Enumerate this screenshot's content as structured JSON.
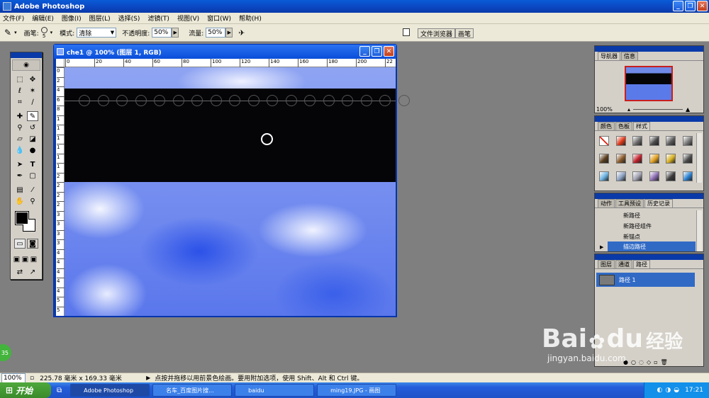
{
  "window": {
    "title": "Adobe Photoshop",
    "minimize": "_",
    "restore": "❐",
    "close": "✕"
  },
  "menu": [
    "文件(F)",
    "编辑(E)",
    "图像(I)",
    "图层(L)",
    "选择(S)",
    "滤镜(T)",
    "视图(V)",
    "窗口(W)",
    "帮助(H)"
  ],
  "options": {
    "brush_label": "画笔:",
    "brush_size": "5",
    "mode_label": "模式:",
    "mode_value": "清除",
    "opacity_label": "不透明度:",
    "opacity_value": "50%",
    "flow_label": "流量:",
    "flow_value": "50%",
    "tab_file_browser": "文件浏览器",
    "tab_brushes": "画笔"
  },
  "document": {
    "title": "che1 @ 100% (图层 1, RGB)",
    "ruler_top": [
      "0",
      "20",
      "40",
      "60",
      "80",
      "100",
      "120",
      "140",
      "160",
      "180",
      "200",
      "22"
    ],
    "ruler_left": [
      "0",
      "2",
      "4",
      "6",
      "8",
      "1",
      "1",
      "1",
      "1",
      "1",
      "1",
      "2",
      "2",
      "2",
      "2",
      "3",
      "3",
      "3",
      "3",
      "4",
      "4",
      "4",
      "4",
      "4",
      "5",
      "5"
    ]
  },
  "navigator": {
    "tabs": [
      "导航器",
      "信息"
    ],
    "zoom": "100%"
  },
  "styles_panel": {
    "tabs": [
      "颜色",
      "色板",
      "样式"
    ],
    "swatches": [
      "#ffffff",
      "#e03a1a",
      "#6b6b6b",
      "#4a4a4a",
      "#5a5a5a",
      "#7a7a7a",
      "#5a3d1e",
      "#8a5a2a",
      "#c0202a",
      "#e0a020",
      "#d8b020",
      "#4a4a4a",
      "#6ab0e0",
      "#8aa0c0",
      "#a0a0b0",
      "#8a6ab0",
      "#3a3a3a",
      "#2a80d0"
    ]
  },
  "history_panel": {
    "tabs": [
      "动作",
      "工具预设",
      "历史记录"
    ],
    "items": [
      "新路径",
      "新路径组件",
      "新锚点",
      "描边路径"
    ],
    "selected_index": 3
  },
  "paths_panel": {
    "tabs": [
      "图层",
      "通道",
      "路径"
    ],
    "items": [
      "路径 1"
    ]
  },
  "statusbar": {
    "zoom": "100%",
    "doc_size": "225.78 毫米 x 169.33 毫米",
    "hint": "点按并拖移以用前景色绘画。要用附加选项，使用 Shift、Alt 和 Ctrl 键。"
  },
  "taskbar": {
    "start": "开始",
    "tasks": [
      "Adobe Photoshop",
      "名车_百度图片搜...",
      "baidu",
      "ming19.JPG - 画图"
    ],
    "clock": "17:21"
  },
  "watermark": {
    "brand": "Bai",
    "brand2": "du",
    "sub": "经验",
    "url": "jingyan.baidu.com"
  },
  "badge": "35",
  "colors": {
    "title_bar": "#0a4ed9",
    "taskbar": "#245edb",
    "start": "#3a8b2a",
    "canvas_band": "#050508"
  }
}
